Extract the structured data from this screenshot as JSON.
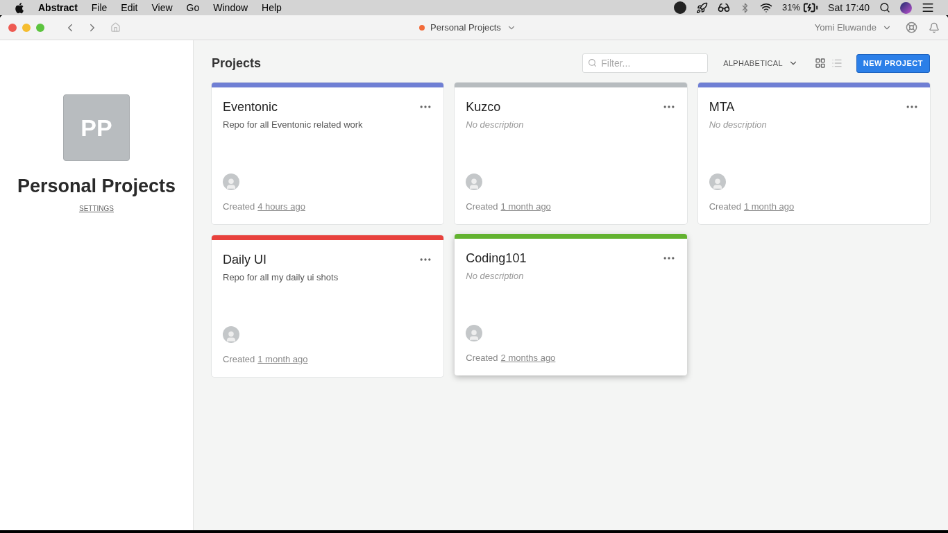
{
  "menu_bar": {
    "app_name": "Abstract",
    "menus": [
      "File",
      "Edit",
      "View",
      "Go",
      "Window",
      "Help"
    ],
    "battery_percent": "31%",
    "clock": "Sat 17:40"
  },
  "window": {
    "workspace": "Personal Projects",
    "user": "Yomi Eluwande"
  },
  "sidebar": {
    "avatar_initials": "PP",
    "title": "Personal Projects",
    "settings_link": "SETTINGS"
  },
  "main": {
    "heading": "Projects",
    "filter": {
      "placeholder": "Filter..."
    },
    "sort": "ALPHABETICAL",
    "view_modes": [
      {
        "kind": "grid",
        "selected": true
      },
      {
        "kind": "list",
        "selected": false
      }
    ],
    "new_button": "NEW PROJECT",
    "projects": [
      {
        "name": "Eventonic",
        "description": "Repo for all Eventonic related work",
        "description_empty": false,
        "color": "#6f7fd4",
        "created_label": "Created",
        "created": "4 hours ago",
        "hovered": false
      },
      {
        "name": "Kuzco",
        "description": "No description",
        "description_empty": true,
        "color": "#b7bcbf",
        "created_label": "Created",
        "created": "1 month ago",
        "hovered": false
      },
      {
        "name": "MTA",
        "description": "No description",
        "description_empty": true,
        "color": "#6f7fd4",
        "created_label": "Created",
        "created": "1 month ago",
        "hovered": false
      },
      {
        "name": "Daily UI",
        "description": "Repo for all my daily ui shots",
        "description_empty": false,
        "color": "#e8413c",
        "created_label": "Created",
        "created": "1 month ago",
        "hovered": false
      },
      {
        "name": "Coding101",
        "description": "No description",
        "description_empty": true,
        "color": "#62b22f",
        "created_label": "Created",
        "created": "2 months ago",
        "hovered": true
      }
    ]
  }
}
